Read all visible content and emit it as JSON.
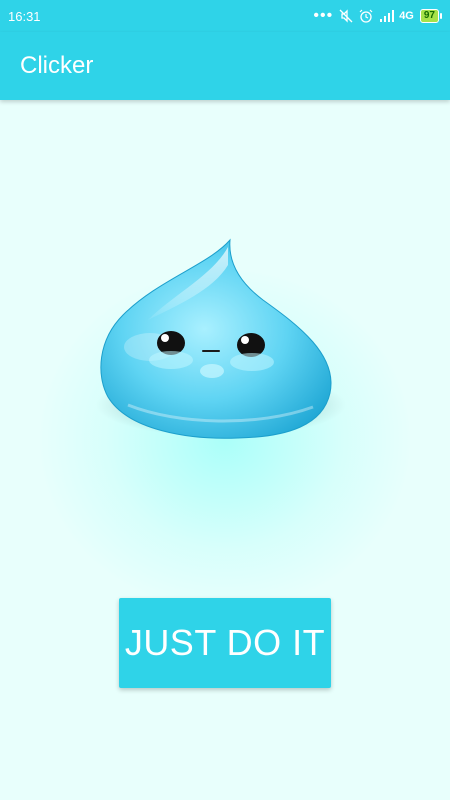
{
  "statusbar": {
    "time": "16:31",
    "more_dots": "•••",
    "icons": [
      "mute-icon",
      "alarm-icon",
      "signal-icon"
    ],
    "network": "4G",
    "battery": "97"
  },
  "appbar": {
    "title": "Clicker"
  },
  "main": {
    "image": "water-drop-blob-character",
    "button_label": "JUST DO IT"
  },
  "colors": {
    "primary": "#2fd3e8",
    "background": "#e8fffc",
    "battery": "#a6e24a"
  }
}
